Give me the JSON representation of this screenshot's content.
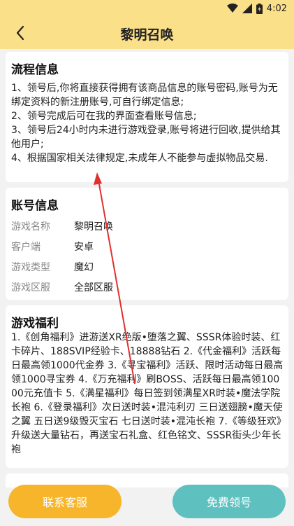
{
  "status_bar": {
    "time": "4:02",
    "icons": [
      "wifi-icon",
      "signal-icon",
      "battery-icon"
    ]
  },
  "header": {
    "title": "黎明召唤",
    "back_icon": "chevron-left-icon"
  },
  "flow_card": {
    "title": "流程信息",
    "items": [
      "1、领号后,你将直接获得拥有该商品信息的账号密码,账号为无绑定资料的新注册账号,可自行绑定信息;",
      "2、领号完成后可在我的界面查看账号信息;",
      "3、领号后24小时内未进行游戏登录,账号将进行回收,提供给其他用户;",
      "4、根据国家相关法律规定,未成年人不能参与虚拟物品交易."
    ]
  },
  "account_card": {
    "title": "账号信息",
    "rows": [
      {
        "label": "游戏名称",
        "value": "黎明召唤"
      },
      {
        "label": "客户端",
        "value": "安卓"
      },
      {
        "label": "游戏类型",
        "value": "魔幻"
      },
      {
        "label": "游戏区服",
        "value": "全部区服"
      }
    ]
  },
  "benefit_card": {
    "title": "游戏福利",
    "text": "1.《创角福利》进游送XR绝版•堕落之翼、SSSR体验时装、红卡碎片、188SVIP经验卡、18888钻石 2.《代金福利》活跃每日最高领1000代金券 3.《寻宝福利》活跃、限时活动每日最高领1000寻宝券 4.《万充福利》刷BOSS、活跃每日最高领10000元充值卡 5.《满星福利》每日签到领满星XR时装•魔法学院长袍 6.《登录福利》次日送时装•混沌利刃 三日送翅膀•魔天使之翼 五日送9级毁灭宝石 七日送时装•混沌长袍 7.《等级狂欢》升级送大量钻石，再送宝石礼盒、红色铭文、SSSR街头少年长袍"
  },
  "buttons": {
    "contact": "联系客服",
    "claim": "免费领号"
  },
  "colors": {
    "header_bg": "#fbe08a",
    "contact_btn": "#f7b52c",
    "claim_btn": "#5fc0c0",
    "annotation_arrow": "#e03030"
  }
}
